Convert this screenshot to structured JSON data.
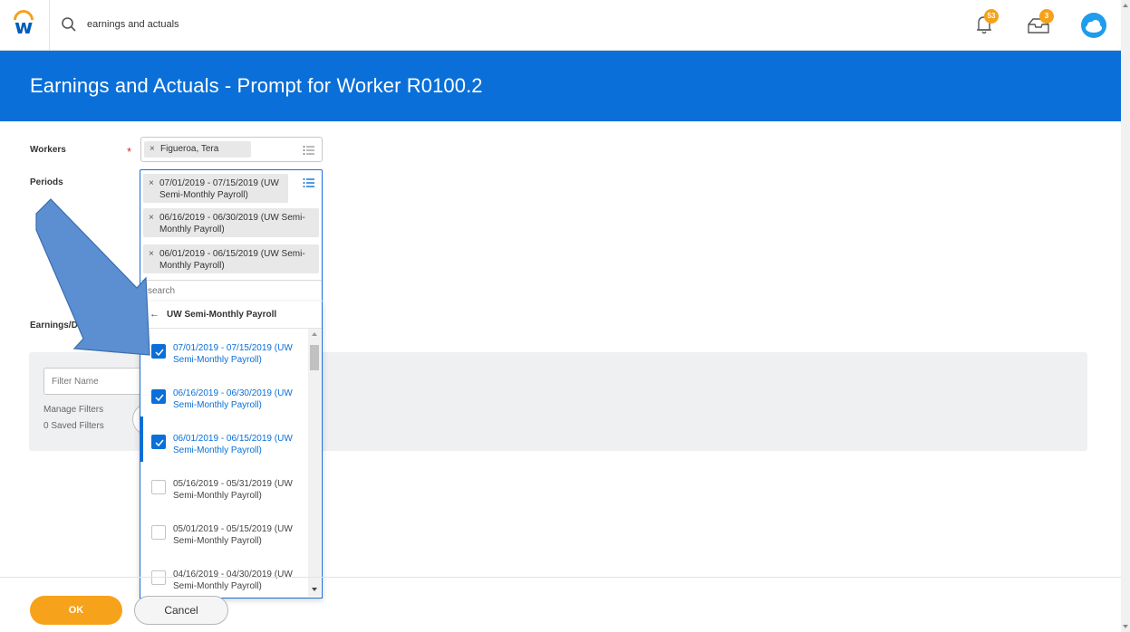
{
  "header": {
    "search_value": "earnings and actuals",
    "notifications_count": "53",
    "inbox_count": "3"
  },
  "banner": {
    "title": "Earnings and Actuals - Prompt for Worker R0100.2"
  },
  "form": {
    "workers_label": "Workers",
    "required_mark": "*",
    "worker_selected": "Figueroa, Tera",
    "periods_label": "Periods",
    "periods_selected": [
      "07/01/2019 - 07/15/2019 (UW Semi-Monthly Payroll)",
      "06/16/2019 - 06/30/2019 (UW Semi-Monthly Payroll)",
      "06/01/2019 - 06/15/2019 (UW Semi-Monthly Payroll)"
    ],
    "periods_search_placeholder": "search",
    "earnings_label": "Earnings/Deduct",
    "remove_glyph": "×"
  },
  "dropdown": {
    "back_glyph": "←",
    "title": "UW Semi-Monthly Payroll",
    "options": [
      {
        "label": "07/01/2019 - 07/15/2019 (UW Semi-Monthly Payroll)",
        "checked": true
      },
      {
        "label": "06/16/2019 - 06/30/2019 (UW Semi-Monthly Payroll)",
        "checked": true
      },
      {
        "label": "06/01/2019 - 06/15/2019 (UW Semi-Monthly Payroll)",
        "checked": true
      },
      {
        "label": "05/16/2019 - 05/31/2019 (UW Semi-Monthly Payroll)",
        "checked": false
      },
      {
        "label": "05/01/2019 - 05/15/2019 (UW Semi-Monthly Payroll)",
        "checked": false
      },
      {
        "label": "04/16/2019 - 04/30/2019 (UW Semi-Monthly Payroll)",
        "checked": false
      }
    ]
  },
  "filters": {
    "filter_name_placeholder": "Filter Name",
    "manage_filters": "Manage Filters",
    "saved_filters": "0 Saved Filters"
  },
  "footer": {
    "ok_label": "OK",
    "cancel_label": "Cancel"
  },
  "colors": {
    "brand_blue": "#0a6fd8",
    "accent_orange": "#f7a21b",
    "annotation_arrow": "#5b8fd1"
  },
  "icons": [
    "workday-logo-icon",
    "search-icon",
    "bell-icon",
    "inbox-icon",
    "cloud-avatar-icon",
    "list-icon",
    "check-icon",
    "back-arrow-icon"
  ]
}
